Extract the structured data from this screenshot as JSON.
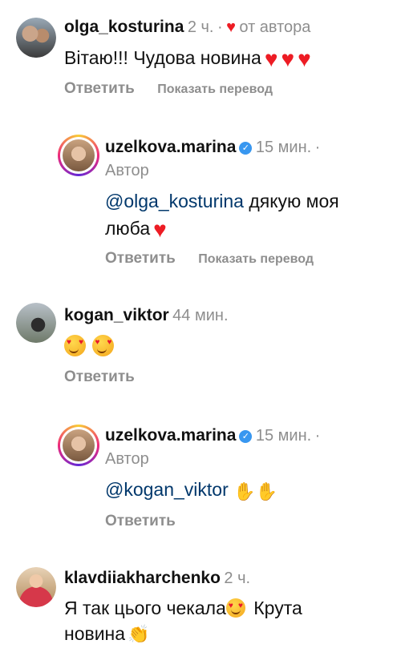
{
  "comments": [
    {
      "username": "olga_kosturina",
      "time": "2 ч.",
      "dot": "·",
      "liked_by_author": "от автора",
      "text": "Вітаю!!! Чудова новина",
      "reply_label": "Ответить",
      "translate_label": "Показать перевод"
    },
    {
      "username": "uzelkova.marina",
      "time": "15 мин.",
      "dot": "·",
      "author_label": "Автор",
      "mention": "@olga_kosturina",
      "text_line1": " дякую моя",
      "text_line2": "люба",
      "reply_label": "Ответить",
      "translate_label": "Показать перевод"
    },
    {
      "username": "kogan_viktor",
      "time": "44 мин.",
      "reply_label": "Ответить"
    },
    {
      "username": "uzelkova.marina",
      "time": "15 мин.",
      "dot": "·",
      "author_label": "Автор",
      "mention": "@kogan_viktor",
      "reply_label": "Ответить"
    },
    {
      "username": "klavdiiakharchenko",
      "time": "2 ч.",
      "text_line1": "Я так цього чекала",
      "text_line1b": " Крута",
      "text_line2": "новина"
    }
  ],
  "colors": {
    "primary_text": "#111111",
    "secondary_text": "#8e8e8e",
    "mention": "#00376b",
    "heart": "#ed1c24",
    "verified": "#3897f0"
  },
  "icons": [
    "heart-icon",
    "verified-badge-icon",
    "heart-eyes-emoji",
    "raised-hands-emoji",
    "clapping-hands-emoji"
  ]
}
